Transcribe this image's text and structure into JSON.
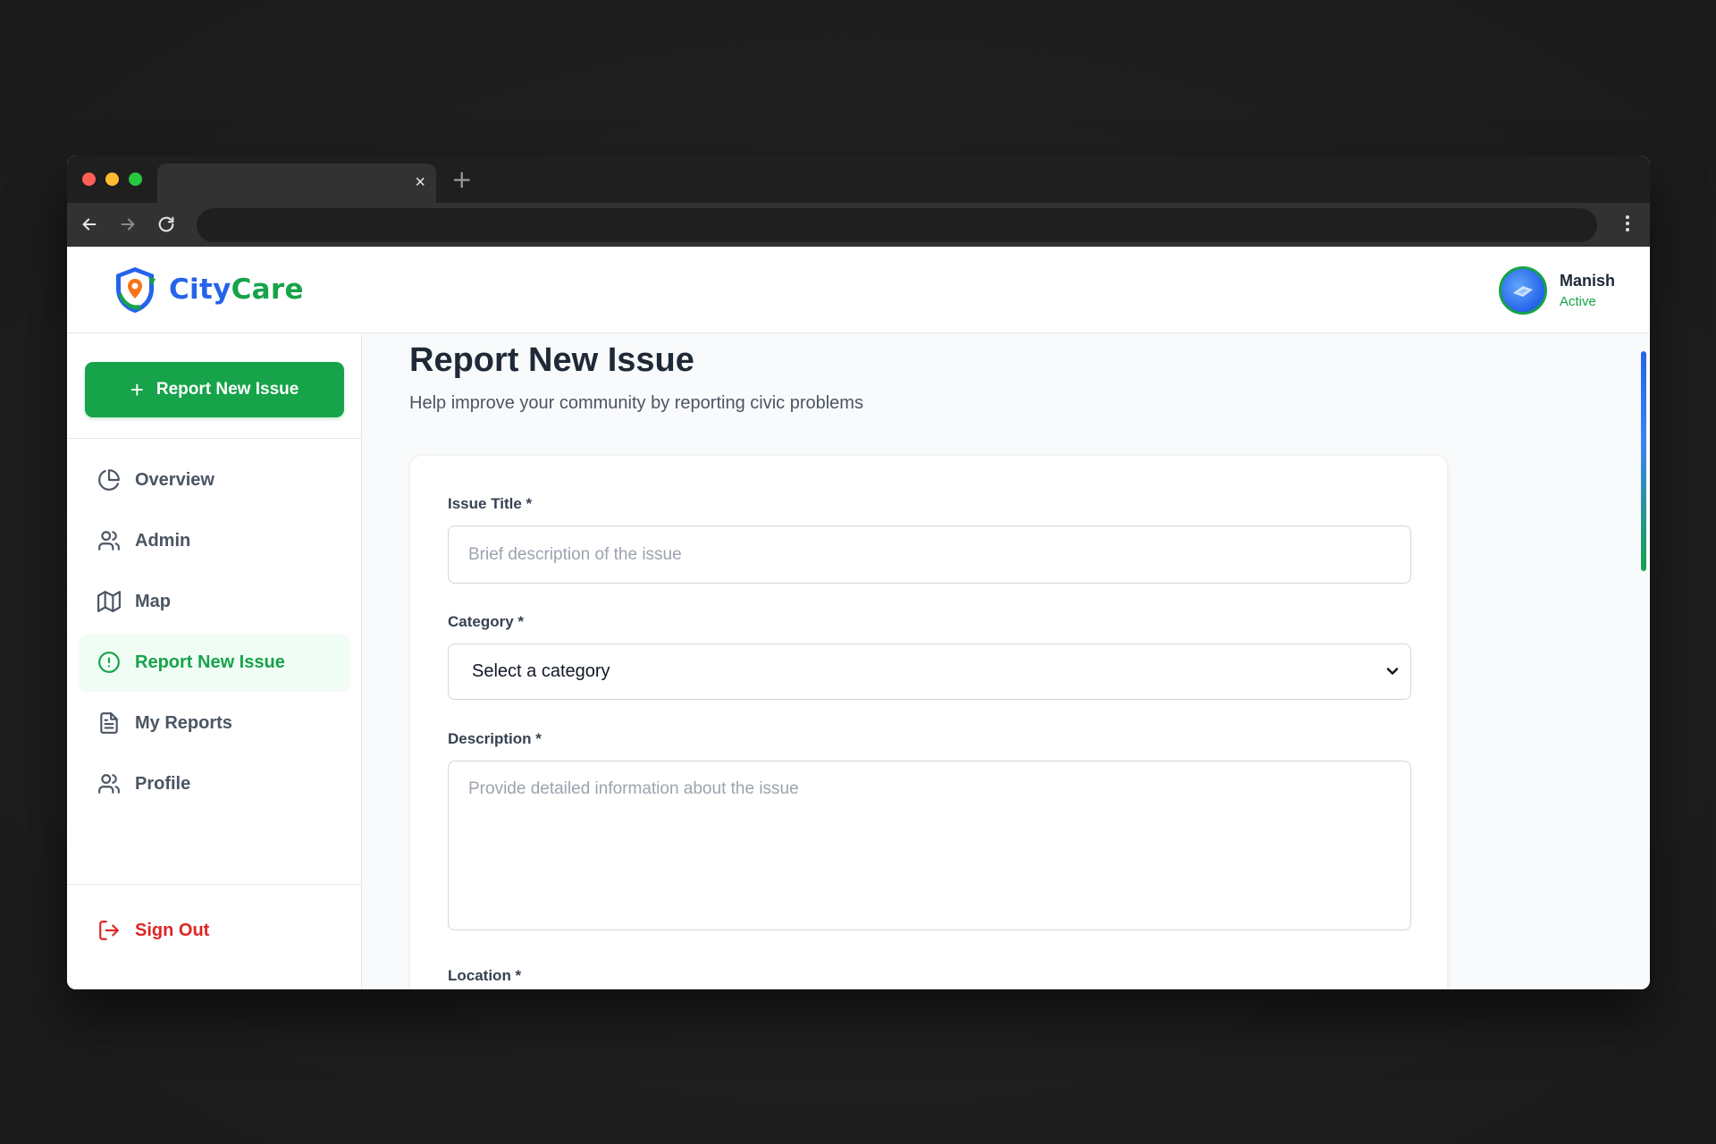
{
  "browser": {
    "tab_close": "×",
    "new_tab": "+"
  },
  "app": {
    "brand_part1": "City",
    "brand_part2": "Care"
  },
  "user": {
    "name": "Manish",
    "status": "Active"
  },
  "sidebar": {
    "cta_label": "Report New Issue",
    "cta_icon": "plus-icon",
    "items": [
      {
        "label": "Overview",
        "icon": "pie-chart-icon",
        "active": false
      },
      {
        "label": "Admin",
        "icon": "users-icon",
        "active": false
      },
      {
        "label": "Map",
        "icon": "map-icon",
        "active": false
      },
      {
        "label": "Report New Issue",
        "icon": "alert-circle-icon",
        "active": true
      },
      {
        "label": "My Reports",
        "icon": "file-text-icon",
        "active": false
      },
      {
        "label": "Profile",
        "icon": "users-icon",
        "active": false
      }
    ],
    "sign_out": "Sign Out"
  },
  "main": {
    "title": "Report New Issue",
    "subtitle": "Help improve your community by reporting civic problems",
    "form": {
      "title_label": "Issue Title *",
      "title_placeholder": "Brief description of the issue",
      "category_label": "Category *",
      "category_value": "Select a category",
      "description_label": "Description *",
      "description_placeholder": "Provide detailed information about the issue",
      "location_label": "Location *"
    }
  },
  "colors": {
    "brand_blue": "#2563eb",
    "brand_green": "#16a34a",
    "danger": "#dc2626",
    "active_bg": "#f0fdf4"
  }
}
